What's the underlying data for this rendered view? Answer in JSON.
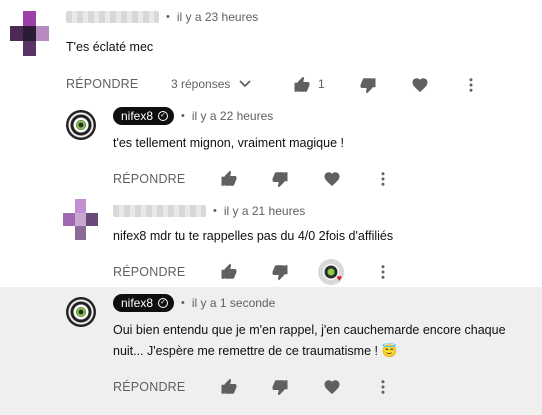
{
  "comments": [
    {
      "time": "il y a 23 heures",
      "text": "T'es éclaté mec",
      "reply_label": "RÉPONDRE",
      "replies_toggle": "3 réponses",
      "like_count": "1"
    },
    {
      "author": "nifex8",
      "time": "il y a 22 heures",
      "text": "t'es tellement mignon, vraiment magique !",
      "reply_label": "RÉPONDRE"
    },
    {
      "time": "il y a 21 heures",
      "text": "nifex8 mdr tu te rappelles pas du 4/0 2fois d'affiliés",
      "reply_label": "RÉPONDRE"
    },
    {
      "author": "nifex8",
      "time": "il y a 1 seconde",
      "text_line1": "Oui bien entendu que je m'en rappel, j'en cauchemarde encore chaque",
      "text_line2": "nuit... J'espère me remettre de ce traumatisme ! 😇",
      "reply_label": "RÉPONDRE"
    }
  ],
  "colors": {
    "highlight_background": "#efefef",
    "text_secondary": "#606060",
    "badge_background": "#0f0f0f",
    "heart_red": "#d81b1b"
  },
  "icons": [
    "thumb-up-icon",
    "thumb-down-icon",
    "heart-icon",
    "more-vert-icon",
    "chevron-down-icon",
    "verified-check-icon",
    "creator-heart-icon"
  ]
}
